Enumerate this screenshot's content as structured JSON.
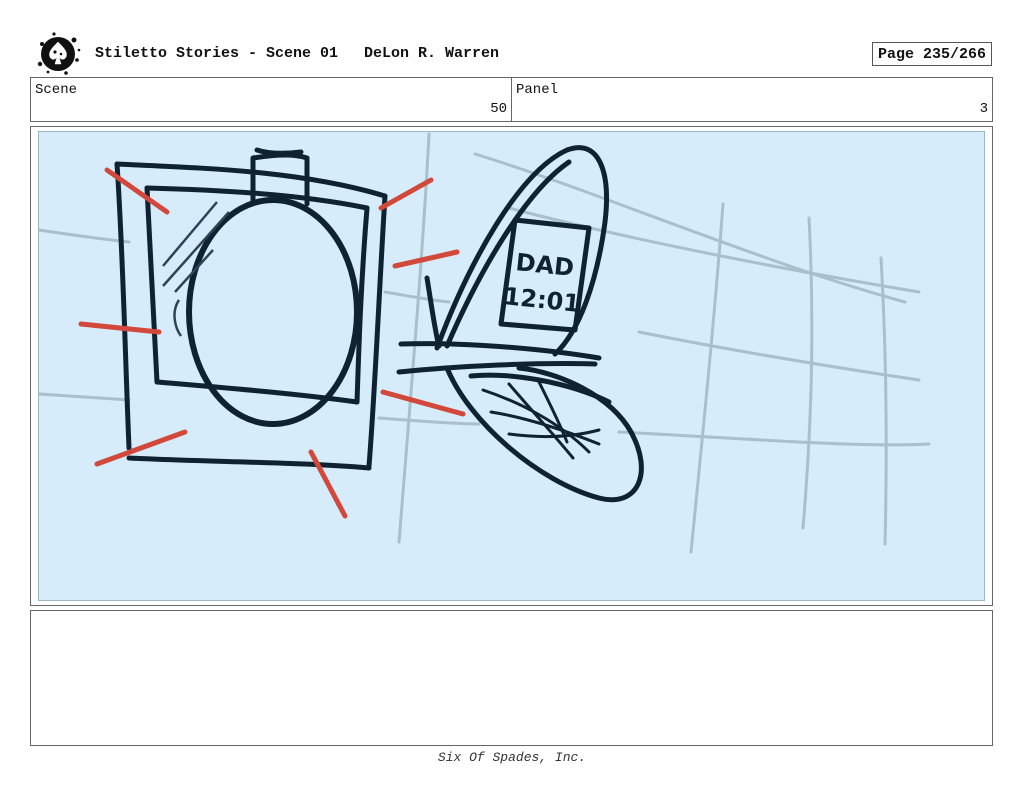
{
  "header": {
    "title": "Stiletto Stories - Scene 01",
    "author": "DeLon R. Warren",
    "page": "Page 235/266"
  },
  "info": {
    "scene_label": "Scene",
    "scene_value": "50",
    "panel_label": "Panel",
    "panel_value": "3"
  },
  "panel": {
    "phone_screen_line1": "DAD",
    "phone_screen_line2": "12:01",
    "colors": {
      "background": "#d6ecfa",
      "ink": "#0f2232",
      "accent": "#d2483b",
      "grid": "#a9bfcb"
    }
  },
  "footer": {
    "company": "Six Of Spades, Inc."
  }
}
